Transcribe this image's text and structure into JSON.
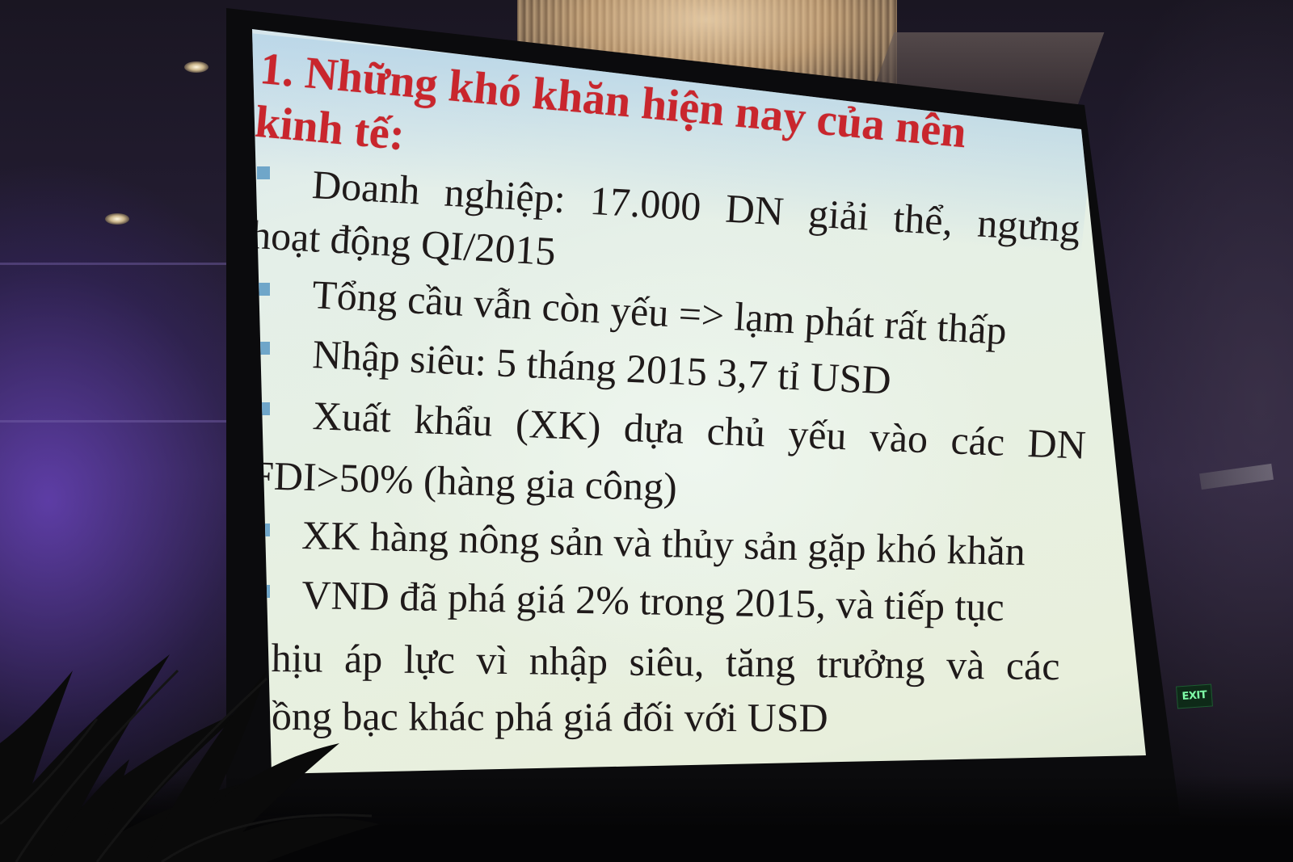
{
  "slide": {
    "title": "1. Những khó khăn hiện nay của nên kinh tế:",
    "bullets": [
      {
        "lines": [
          "Doanh nghiệp: 17.000 DN giải thể, ngưng",
          "hoạt động QI/2015"
        ]
      },
      {
        "lines": [
          "Tổng cầu vẫn còn yếu => lạm phát rất thấp"
        ]
      },
      {
        "lines": [
          "Nhập siêu: 5 tháng 2015 3,7 tỉ USD"
        ]
      },
      {
        "lines": [
          "Xuất khẩu (XK) dựa chủ yếu vào các DN",
          "FDI>50% (hàng gia công)"
        ]
      },
      {
        "lines": [
          "XK hàng nông sản và thủy sản gặp khó khăn"
        ]
      },
      {
        "lines": [
          "VND đã phá giá 2% trong 2015, và tiếp tục",
          "hịu áp lực vì nhập siêu, tăng trưởng và các",
          "ồng bạc khác phá giá đối với USD"
        ]
      }
    ]
  },
  "room": {
    "exit_sign": "EXIT",
    "icons": [
      "ceiling-light-icon",
      "chandelier",
      "palm-plant",
      "exit-sign"
    ]
  },
  "colors": {
    "title": "#c9262d",
    "bullet_marker": "#6fa6c9",
    "body_text": "#1f1a1a",
    "screen": "#e6efe4"
  }
}
